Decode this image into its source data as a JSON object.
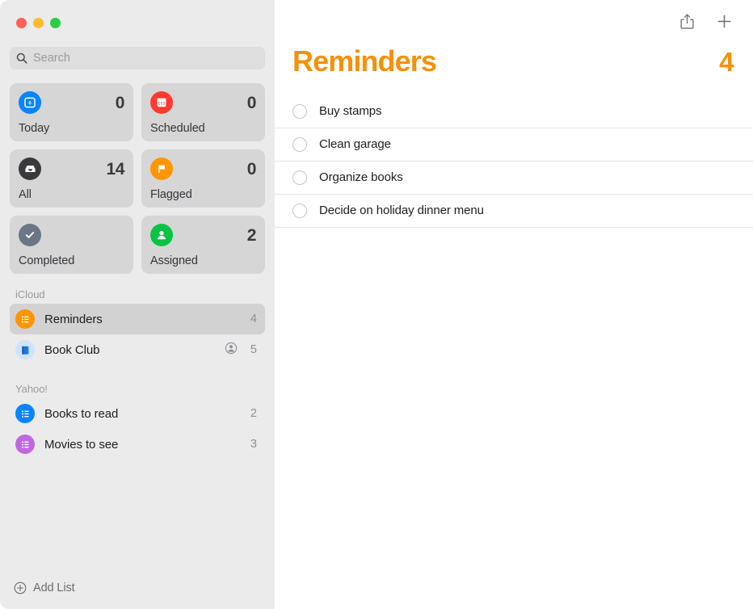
{
  "window": {
    "traffic_lights": [
      {
        "name": "close",
        "color": "#ff6159"
      },
      {
        "name": "minimize",
        "color": "#ffbd2e"
      },
      {
        "name": "maximize",
        "color": "#2ace42"
      }
    ]
  },
  "search": {
    "placeholder": "Search",
    "value": "",
    "icon": "search-icon"
  },
  "smart_lists": [
    {
      "id": "today",
      "label": "Today",
      "count": "0",
      "icon": "calendar-day-icon",
      "icon_bg": "#0a84ff"
    },
    {
      "id": "scheduled",
      "label": "Scheduled",
      "count": "0",
      "icon": "calendar-icon",
      "icon_bg": "#ff3b30"
    },
    {
      "id": "all",
      "label": "All",
      "count": "14",
      "icon": "inbox-tray-icon",
      "icon_bg": "#3a3a3c"
    },
    {
      "id": "flagged",
      "label": "Flagged",
      "count": "0",
      "icon": "flag-icon",
      "icon_bg": "#ff9500"
    },
    {
      "id": "completed",
      "label": "Completed",
      "count": "",
      "icon": "checkmark-icon",
      "icon_bg": "#6b7786"
    },
    {
      "id": "assigned",
      "label": "Assigned",
      "count": "2",
      "icon": "person-icon",
      "icon_bg": "#0ac344"
    }
  ],
  "accounts": [
    {
      "header": "iCloud",
      "lists": [
        {
          "id": "reminders",
          "name": "Reminders",
          "count": "4",
          "icon": "bullet-list-icon",
          "icon_bg": "#ff9500",
          "selected": true,
          "shared": false
        },
        {
          "id": "book-club",
          "name": "Book Club",
          "count": "5",
          "icon": "book-icon",
          "icon_bg": "#cfe4fb",
          "selected": false,
          "shared": true,
          "shared_icon": "shared-person-icon"
        }
      ]
    },
    {
      "header": "Yahoo!",
      "lists": [
        {
          "id": "books-to-read",
          "name": "Books to read",
          "count": "2",
          "icon": "bullet-list-icon",
          "icon_bg": "#0a84ff",
          "selected": false,
          "shared": false
        },
        {
          "id": "movies-to-see",
          "name": "Movies to see",
          "count": "3",
          "icon": "bullet-list-icon",
          "icon_bg": "#c069dd",
          "selected": false,
          "shared": false
        }
      ]
    }
  ],
  "add_list": {
    "label": "Add List",
    "icon": "plus-circle-icon"
  },
  "toolbar": {
    "share_icon": "share-icon",
    "add_icon": "plus-icon"
  },
  "main": {
    "title": "Reminders",
    "count": "4",
    "accent_color": "#f79009",
    "reminders": [
      {
        "id": "r1",
        "text": "Buy stamps",
        "completed": false
      },
      {
        "id": "r2",
        "text": "Clean garage",
        "completed": false
      },
      {
        "id": "r3",
        "text": "Organize books",
        "completed": false
      },
      {
        "id": "r4",
        "text": "Decide on holiday dinner menu",
        "completed": false
      }
    ]
  }
}
